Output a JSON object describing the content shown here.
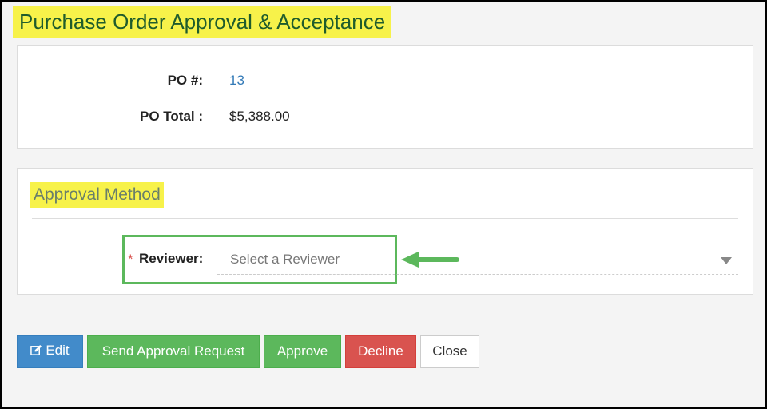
{
  "page": {
    "title": "Purchase Order Approval & Acceptance"
  },
  "po_details": {
    "po_number_label": "PO #:",
    "po_number_value": "13",
    "po_total_label": "PO Total :",
    "po_total_value": "$5,388.00"
  },
  "approval_method": {
    "section_title": "Approval Method",
    "required_marker": "*",
    "reviewer_label": "Reviewer:",
    "reviewer_placeholder": "Select a Reviewer"
  },
  "actions": {
    "edit_label": "Edit",
    "send_label": "Send Approval Request",
    "approve_label": "Approve",
    "decline_label": "Decline",
    "close_label": "Close"
  },
  "icons": {
    "edit": "edit-icon",
    "dropdown": "chevron-down-icon",
    "callout": "arrow-left-icon"
  },
  "colors": {
    "title_highlight": "#f7f24a",
    "title_text": "#1f5c2c",
    "link": "#337ab7",
    "primary": "#428bca",
    "success": "#5cb85c",
    "danger": "#d9534f",
    "required": "#d9534f"
  }
}
